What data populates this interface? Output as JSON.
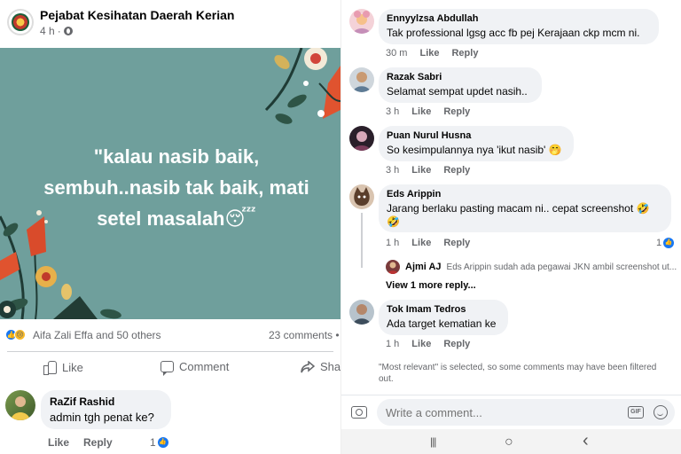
{
  "left": {
    "page_name": "Pejabat Kesihatan Daerah Kerian",
    "post_time": "4 h",
    "quote_lines": [
      "\"kalau nasib baik,",
      "sembuh..nasib tak baik, mati",
      "setel masalah"
    ],
    "quote_emoji": "😴",
    "reactions_text": "Aifa Zali Effa and 50 others",
    "comments_count": "23 comments •",
    "actions": {
      "like": "Like",
      "comment": "Comment",
      "share": "Share"
    },
    "comment": {
      "name": "RaZif Rashid",
      "text": "admin tgh penat ke?",
      "like_label": "Like",
      "reply_label": "Reply",
      "like_count": "1"
    }
  },
  "right": {
    "comments": [
      {
        "name": "Ennyylzsa Abdullah",
        "text": "Tak professional lgsg acc fb pej Kerajaan ckp mcm ni.",
        "time": "30 m",
        "like": "Like",
        "reply": "Reply"
      },
      {
        "name": "Razak Sabri",
        "text": "Selamat sempat updet nasih..",
        "time": "3 h",
        "like": "Like",
        "reply": "Reply"
      },
      {
        "name": "Puan Nurul Husna",
        "text": "So kesimpulannya nya 'ikut nasib'",
        "text_emoji": "🤭",
        "time": "3 h",
        "like": "Like",
        "reply": "Reply"
      },
      {
        "name": "Eds Arippin",
        "text": "Jarang berlaku pasting macam ni.. cepat screenshot",
        "text_emoji": "🤣",
        "text_line2": "🤣",
        "time": "1 h",
        "like": "Like",
        "reply": "Reply",
        "like_count": "1"
      },
      {
        "name": "Tok Imam Tedros",
        "text": "Ada target kematian ke",
        "time": "1 h",
        "like": "Like",
        "reply": "Reply"
      }
    ],
    "nested_reply": {
      "name": "Ajmi AJ",
      "text": "Eds Arippin sudah ada pegawai JKN ambil screenshot ut..."
    },
    "view_more": "View 1 more reply...",
    "footnote": "\"Most relevant\" is selected, so some comments may have been filtered out.",
    "composer_placeholder": "Write a comment...",
    "gif_label": "GIF",
    "nav": {
      "recents": "|||",
      "home": "○",
      "back": "‹"
    }
  },
  "colors": {
    "image_bg": "#6f9f9c",
    "like_blue": "#1877f2",
    "bubble": "#f0f2f5",
    "muted": "#65676b"
  }
}
